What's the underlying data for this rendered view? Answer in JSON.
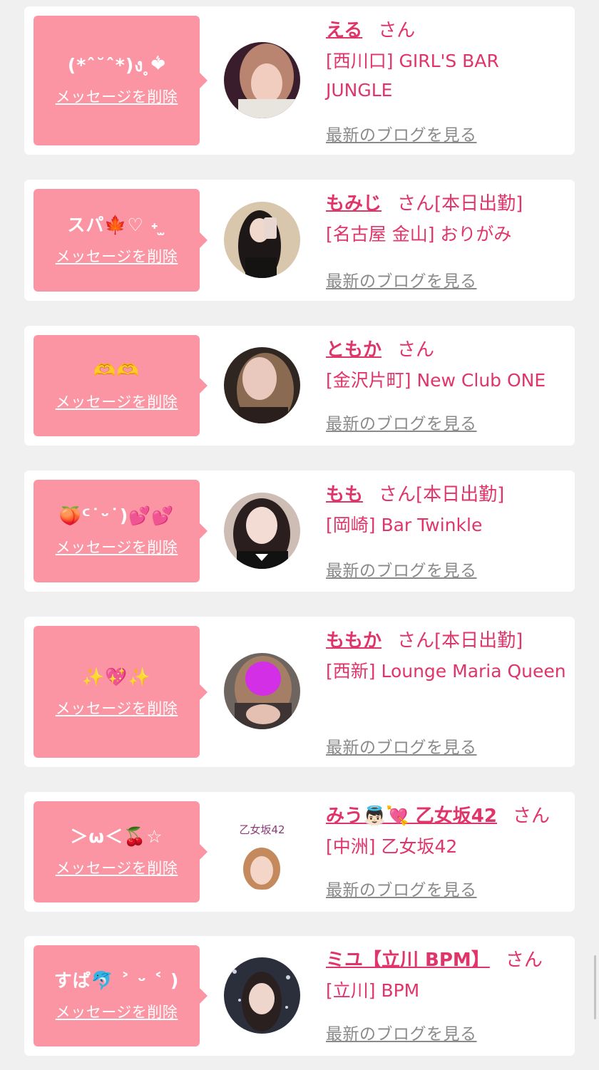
{
  "common": {
    "delete_label": "メッセージを削除",
    "blog_label": "最新のブログを見る",
    "san_label": "さん"
  },
  "items": [
    {
      "bubble": "(*ˆ˘ˆ*)ง ̥ܵ❤",
      "name": "える",
      "badge": "",
      "shop": "[西川口] GIRL'S BAR JUNGLE"
    },
    {
      "bubble": "スパ🍁♡ ˖ ̫ ",
      "name": "もみじ",
      "badge": "[本日出勤]",
      "shop": "[名古屋 金山] おりがみ"
    },
    {
      "bubble": "🫶🫶",
      "name": "ともか",
      "badge": "",
      "shop": "[金沢片町] New Club ONE"
    },
    {
      "bubble": "🍑ᑦ˙ᵕ˙)💕💕",
      "name": "もも",
      "badge": "[本日出勤]",
      "shop": "[岡崎] Bar Twinkle"
    },
    {
      "bubble": "✨💖✨",
      "name": "ももか",
      "badge": "[本日出勤]",
      "shop": "[西新] Lounge Maria Queen"
    },
    {
      "bubble": "＞ω＜🍒☆",
      "name": "みう👼🏻💘 乙女坂42",
      "badge": "",
      "shop": "[中洲] 乙女坂42",
      "avatar_caption": "乙女坂42"
    },
    {
      "bubble": "すぱ🐬 ˃ ᵕ ˂ )",
      "name": "ミユ【立川 BPM】",
      "badge": "",
      "shop": "[立川] BPM"
    }
  ],
  "colors": {
    "accent": "#e0356a",
    "bubble": "#fb95a4",
    "card": "#ffffff",
    "background": "#f0f0f0",
    "muted_link": "#8a8a8a"
  }
}
